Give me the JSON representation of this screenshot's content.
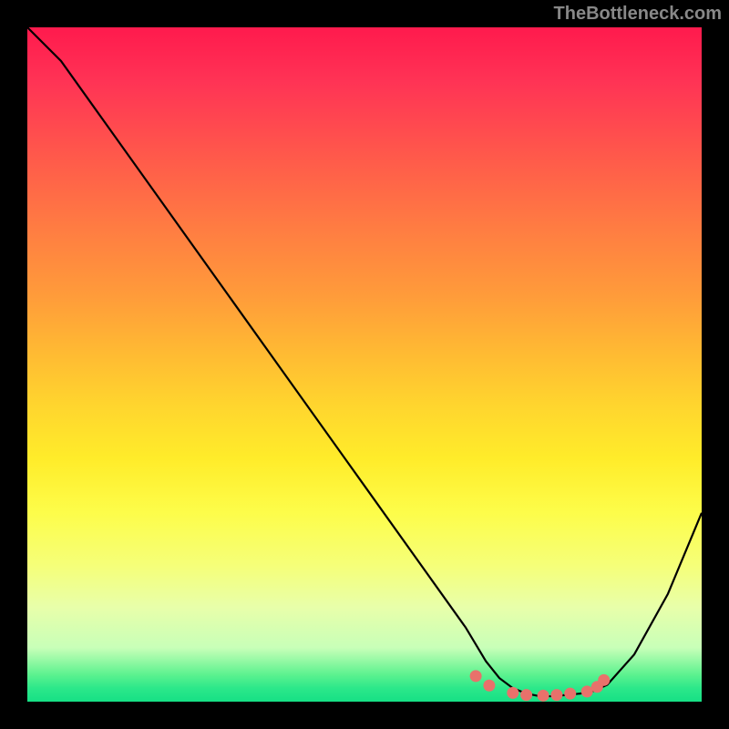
{
  "watermark": "TheBottleneck.com",
  "chart_data": {
    "type": "line",
    "title": "",
    "xlabel": "",
    "ylabel": "",
    "xlim": [
      0,
      100
    ],
    "ylim": [
      0,
      100
    ],
    "series": [
      {
        "name": "curve",
        "x": [
          0,
          5,
          10,
          20,
          30,
          40,
          50,
          60,
          65,
          68,
          70,
          72,
          74,
          76,
          78,
          80,
          82,
          84,
          86,
          90,
          95,
          100
        ],
        "y": [
          100,
          95,
          88,
          74,
          60,
          46,
          32,
          18,
          11,
          6,
          3.5,
          2,
          1.2,
          0.8,
          0.8,
          1,
          1.2,
          1.6,
          2.5,
          7,
          16,
          28
        ]
      }
    ],
    "markers": [
      {
        "x": 66.5,
        "y": 3.8
      },
      {
        "x": 68.5,
        "y": 2.4
      },
      {
        "x": 72.0,
        "y": 1.3
      },
      {
        "x": 74.0,
        "y": 1.0
      },
      {
        "x": 76.5,
        "y": 0.9
      },
      {
        "x": 78.5,
        "y": 1.0
      },
      {
        "x": 80.5,
        "y": 1.2
      },
      {
        "x": 83.0,
        "y": 1.5
      },
      {
        "x": 84.5,
        "y": 2.2
      },
      {
        "x": 85.5,
        "y": 3.2
      }
    ],
    "marker_color": "#e8716b",
    "curve_color": "#000000"
  }
}
